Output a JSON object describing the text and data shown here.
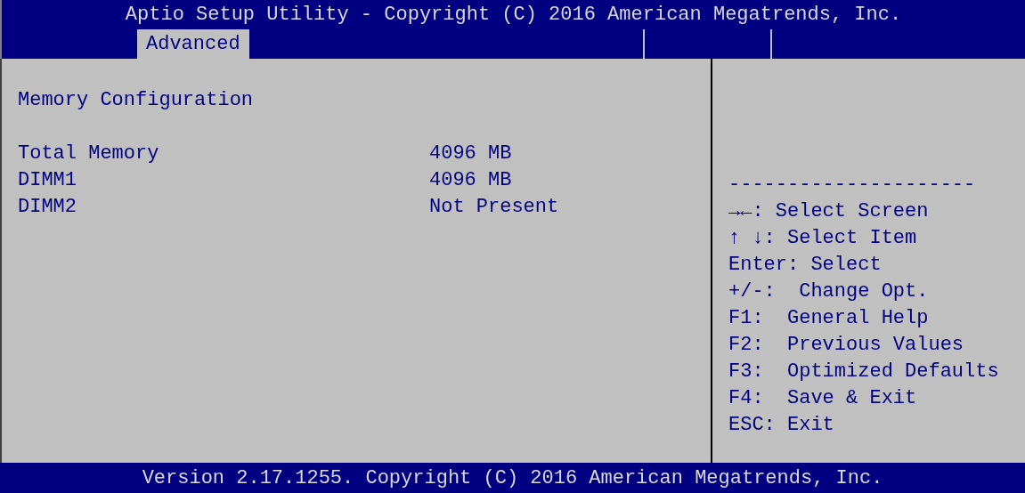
{
  "window": {
    "title": "Aptio Setup Utility - Copyright (C) 2016 American Megatrends, Inc."
  },
  "tabs": [
    {
      "label": "Advanced",
      "selected": true
    }
  ],
  "main": {
    "heading": "Memory Configuration",
    "rows": [
      {
        "label": "Total Memory",
        "value": "4096 MB"
      },
      {
        "label": "DIMM1",
        "value": "4096 MB"
      },
      {
        "label": "DIMM2",
        "value": "Not Present"
      }
    ]
  },
  "help": {
    "separator": "---------------------",
    "keys": [
      "→←: Select Screen",
      "↑ ↓: Select Item",
      "Enter: Select",
      "+/-:  Change Opt.",
      "F1:  General Help",
      "F2:  Previous Values",
      "F3:  Optimized Defaults",
      "F4:  Save & Exit",
      "ESC: Exit"
    ]
  },
  "status_bar": "Version 2.17.1255. Copyright (C) 2016 American Megatrends, Inc."
}
